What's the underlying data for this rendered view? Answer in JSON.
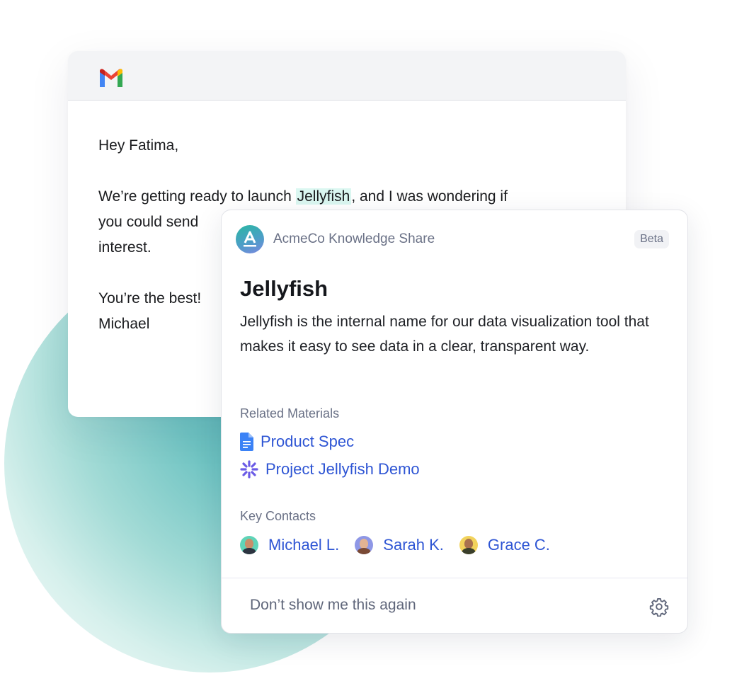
{
  "email": {
    "app_icon": "gmail-logo-icon",
    "greeting": "Hey Fatima,",
    "paragraph": {
      "before": "We’re getting ready to launch ",
      "highlight": "Jellyfish",
      "after_line1": ", and I was wondering if",
      "line2": "you could send",
      "line3": "interest."
    },
    "closing": "You’re the best!",
    "signature": "Michael"
  },
  "popup": {
    "app_icon": "acmeco-logo-icon",
    "app_name": "AcmeCo Knowledge Share",
    "badge": "Beta",
    "title": "Jellyfish",
    "description": "Jellyfish is the internal name for our data visualization tool that makes it easy to see data in a clear, transparent way.",
    "related_label": "Related Materials",
    "materials": [
      {
        "icon": "google-doc-icon",
        "label": "Product Spec"
      },
      {
        "icon": "sparkle-icon",
        "label": "Project Jellyfish Demo"
      }
    ],
    "contacts_label": "Key Contacts",
    "contacts": [
      {
        "name": "Michael L.",
        "avatar_bg": "#5fd4b8"
      },
      {
        "name": "Sarah K.",
        "avatar_bg": "#8e97e6"
      },
      {
        "name": "Grace C.",
        "avatar_bg": "#f2d35c"
      }
    ],
    "dismiss_label": "Don’t show me this again",
    "settings_icon": "gear-icon"
  },
  "colors": {
    "link": "#2e55d4",
    "highlight": "#dbf7f1",
    "muted": "#6a7186"
  }
}
